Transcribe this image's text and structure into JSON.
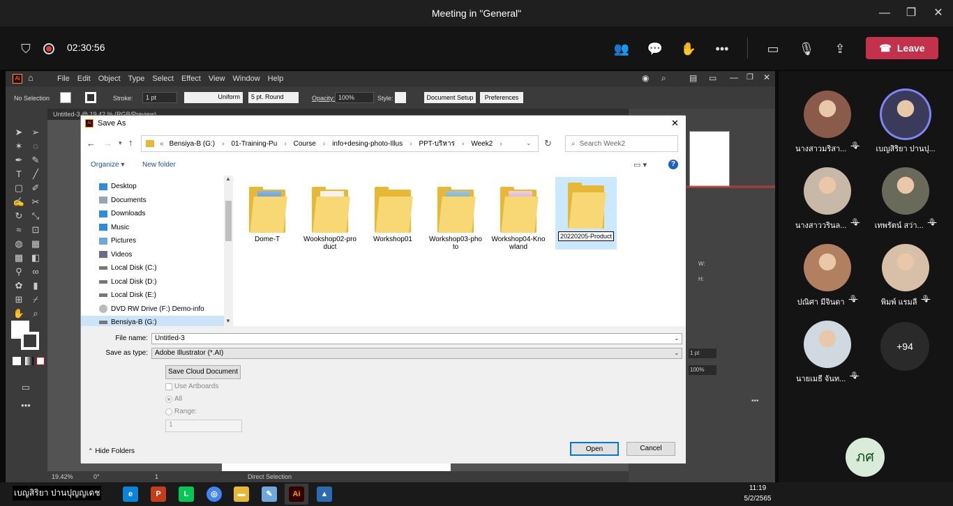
{
  "meeting": {
    "title": "Meeting in \"General\"",
    "timer": "02:30:56",
    "leave_label": "Leave"
  },
  "illustrator": {
    "menu": [
      "File",
      "Edit",
      "Object",
      "Type",
      "Select",
      "Effect",
      "View",
      "Window",
      "Help"
    ],
    "selection": "No Selection",
    "stroke_label": "Stroke:",
    "stroke_value": "1 pt",
    "uniform": "Uniform",
    "brush": "5 pt. Round",
    "opacity_label": "Opacity:",
    "opacity_value": "100%",
    "style_label": "Style:",
    "doc_setup": "Document Setup",
    "preferences": "Preferences",
    "doc_tab": "Untitled-3 @ 19.42 % (RGB/Preview)",
    "zoom": "19.42%",
    "rotation": "0°",
    "artboard": "1",
    "status": "Direct Selection",
    "panel_w": "W:",
    "panel_h": "H:",
    "panel_stroke": "1 pt",
    "panel_opacity": "100%"
  },
  "dialog": {
    "title": "Save As",
    "breadcrumbs": [
      "Bensiya-B (G:)",
      "01-Training-Pu",
      "Course",
      "info+desing-photo-Illus",
      "PPT-บริหาร",
      "Week2"
    ],
    "search_placeholder": "Search Week2",
    "organize": "Organize",
    "new_folder": "New folder",
    "nav_items": [
      {
        "label": "Desktop",
        "icon": "desktop-icon"
      },
      {
        "label": "Documents",
        "icon": "documents-icon"
      },
      {
        "label": "Downloads",
        "icon": "downloads-icon"
      },
      {
        "label": "Music",
        "icon": "music-icon"
      },
      {
        "label": "Pictures",
        "icon": "pictures-icon"
      },
      {
        "label": "Videos",
        "icon": "videos-icon"
      },
      {
        "label": "Local Disk (C:)",
        "icon": "drive-icon"
      },
      {
        "label": "Local Disk (D:)",
        "icon": "drive-icon"
      },
      {
        "label": "Local Disk (E:)",
        "icon": "drive-icon"
      },
      {
        "label": "DVD RW Drive (F:) Demo-info",
        "icon": "dvd-icon"
      },
      {
        "label": "Bensiya-B (G:)",
        "icon": "drive-icon"
      }
    ],
    "folders": [
      {
        "line1": "Dome-T",
        "line2": ""
      },
      {
        "line1": "Wookshop02-pro",
        "line2": "duct"
      },
      {
        "line1": "Workshop01",
        "line2": ""
      },
      {
        "line1": "Workshop03-pho",
        "line2": "to"
      },
      {
        "line1": "Workshop04-Kno",
        "line2": "wland"
      }
    ],
    "rename_value": "20220205-Product",
    "file_name_label": "File name:",
    "file_name_value": "Untitled-3",
    "save_type_label": "Save as type:",
    "save_type_value": "Adobe Illustrator (*.AI)",
    "save_cloud": "Save Cloud Document",
    "use_artboards": "Use Artboards",
    "all": "All",
    "range": "Range:",
    "range_value": "1",
    "hide_folders": "Hide Folders",
    "open": "Open",
    "cancel": "Cancel"
  },
  "participants": [
    {
      "name": "นางสาวมริสา...",
      "muted": true,
      "color": "#8a5a4a"
    },
    {
      "name": "เบญสิริยา ปานปุ...",
      "muted": false,
      "color": "#3a3a5a"
    },
    {
      "name": "นางสาววรินล...",
      "muted": true,
      "color": "#c8b8a8"
    },
    {
      "name": "เทพรัตน์ สว่า...",
      "muted": true,
      "color": "#6a6a5a"
    },
    {
      "name": "ปณิศา มีจินดา",
      "muted": true,
      "color": "#b08060"
    },
    {
      "name": "พิมพ์ แรมลี",
      "muted": true,
      "color": "#d8c0a8"
    },
    {
      "name": "นายเมธี จันท...",
      "muted": true,
      "color": "#d0d8e0"
    }
  ],
  "more_count": "+94",
  "self_initials": "ภศ",
  "presenter": "เบญสิริยา ปานปุญญเดช",
  "clock": {
    "time": "11:19",
    "date": "5/2/2565"
  }
}
